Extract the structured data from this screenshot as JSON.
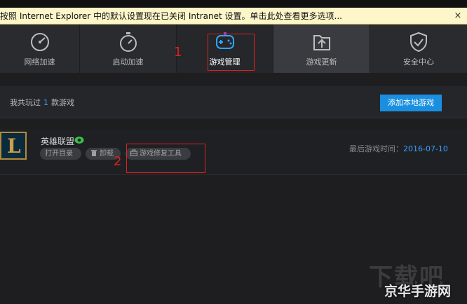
{
  "info_bar": {
    "text": "按照 Internet Explorer 中的默认设置现在已关闭 Intranet 设置。单击此处查看更多选项...",
    "close_label": "×"
  },
  "nav": {
    "tabs": [
      {
        "label": "网络加速",
        "icon": "speedometer-icon"
      },
      {
        "label": "启动加速",
        "icon": "stopwatch-icon"
      },
      {
        "label": "游戏管理",
        "icon": "gamepad-icon",
        "active": true
      },
      {
        "label": "游戏更新",
        "icon": "folder-upload-icon"
      },
      {
        "label": "安全中心",
        "icon": "shield-check-icon"
      }
    ]
  },
  "annotations": {
    "mark1": "1",
    "mark2": "2"
  },
  "summary": {
    "prefix": "我共玩过",
    "count": "1",
    "suffix": "款游戏",
    "add_button": "添加本地游戏"
  },
  "game": {
    "name": "英雄联盟",
    "logo_letter": "L",
    "actions": {
      "open_dir": "打开目录",
      "uninstall": "卸载",
      "repair": "游戏修复工具"
    },
    "last_played_label": "最后游戏时间：",
    "last_played_date": "2016-07-10"
  },
  "watermark": {
    "top": "下载吧",
    "bottom": "京华手游网"
  },
  "colors": {
    "accent_blue": "#1a8fe0",
    "link_blue": "#3aa0ff",
    "annotation_red": "#e02020"
  }
}
